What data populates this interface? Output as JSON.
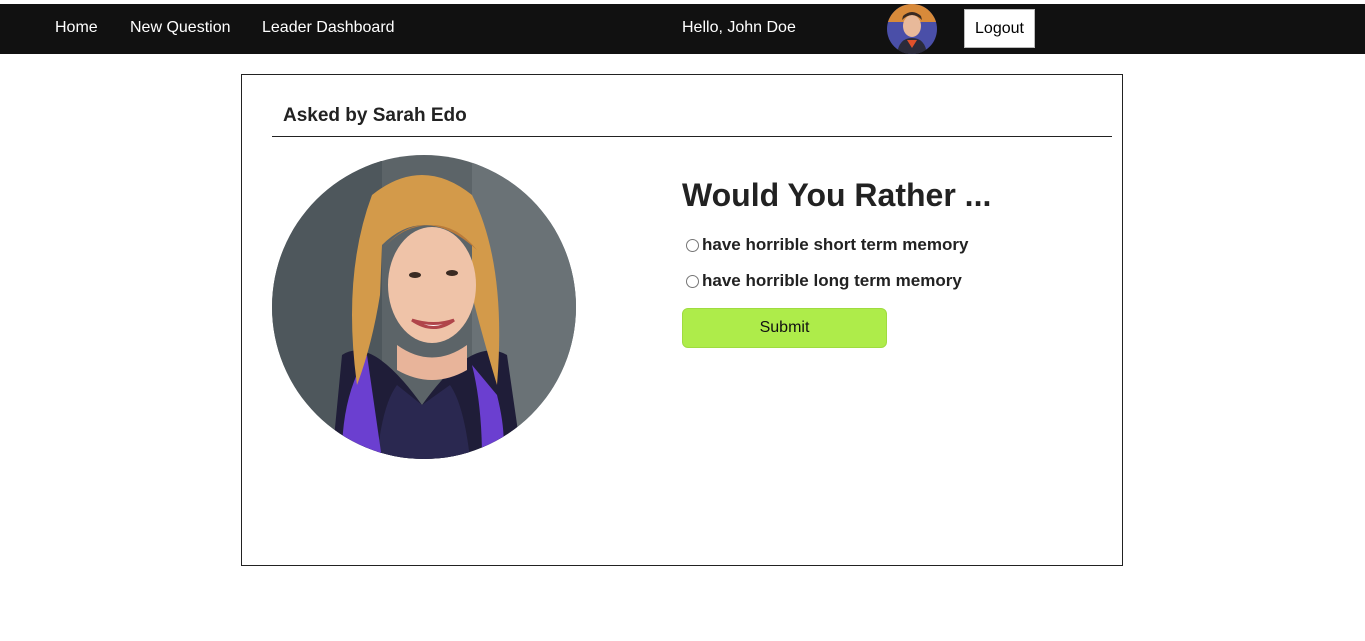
{
  "nav": {
    "home_label": "Home",
    "new_question_label": "New Question",
    "leader_dashboard_label": "Leader Dashboard",
    "greeting": "Hello, John Doe",
    "logout_label": "Logout"
  },
  "question": {
    "asked_by": "Asked by Sarah Edo",
    "title": "Would You Rather ...",
    "options": [
      {
        "label": "have horrible short term memory",
        "selected": false
      },
      {
        "label": "have horrible long term memory",
        "selected": false
      }
    ],
    "submit_label": "Submit"
  },
  "colors": {
    "nav_background": "#111111",
    "submit_background": "#aeec4a"
  },
  "icons": {
    "user_avatar": "user-avatar-photo",
    "author_avatar": "author-avatar-photo"
  }
}
